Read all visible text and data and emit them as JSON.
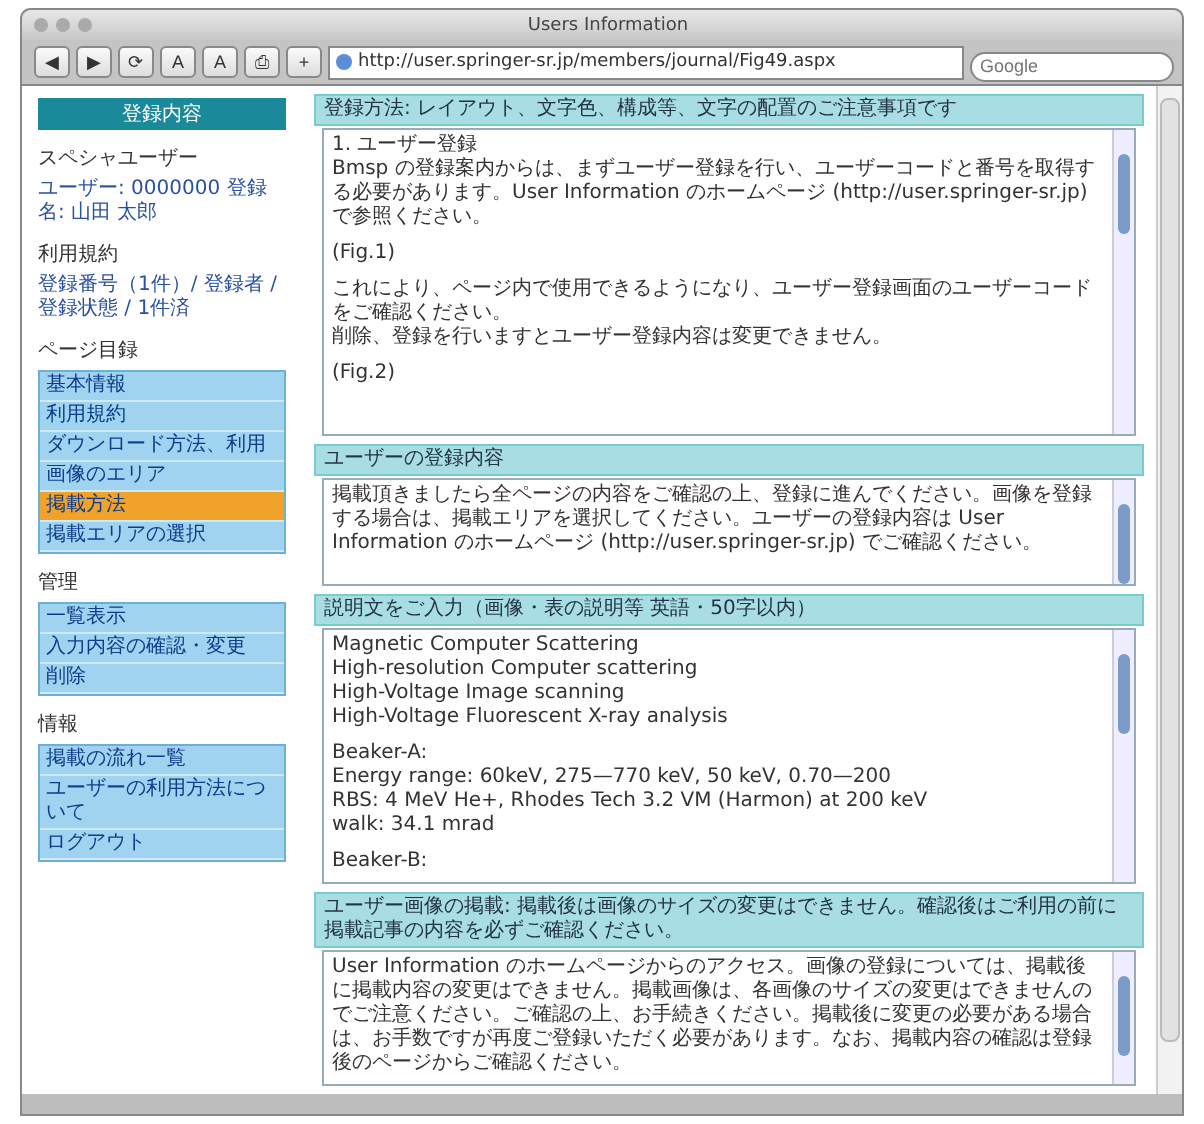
{
  "window": {
    "title": "Users Information"
  },
  "toolbar": {
    "buttons": [
      {
        "label": "◀"
      },
      {
        "label": "▶"
      },
      {
        "label": "⟳"
      },
      {
        "label": "A"
      },
      {
        "label": "A"
      },
      {
        "label": "⎙"
      },
      {
        "label": "+"
      }
    ],
    "url": "http://user.springer-sr.jp/members/journal/Fig49.aspx",
    "search": {
      "placeholder": "Google"
    }
  },
  "sidebar": {
    "header": "登録内容",
    "user_title": "スペシャユーザー",
    "user_line": "ユーザー: 0000000 登録名: 山田 太郎",
    "terms_title": "利用規約",
    "terms_text": "登録番号（1件）/ 登録者 / 登録状態 / 1件済",
    "groups": [
      {
        "title": "ページ目録",
        "items": [
          {
            "label": "基本情報",
            "selected": false
          },
          {
            "label": "利用規約",
            "selected": false
          },
          {
            "label": "ダウンロード方法、利用",
            "selected": false
          },
          {
            "label": "画像のエリア",
            "selected": false
          },
          {
            "label": "掲載方法",
            "selected": true
          },
          {
            "label": "掲載エリアの選択",
            "selected": false
          }
        ]
      },
      {
        "title": "管理",
        "items": [
          {
            "label": "一覧表示",
            "selected": false
          },
          {
            "label": "入力内容の確認・変更",
            "selected": false
          },
          {
            "label": "削除",
            "selected": false
          }
        ]
      },
      {
        "title": "情報",
        "items": [
          {
            "label": "掲載の流れ一覧",
            "selected": false
          },
          {
            "label": "ユーザーの利用方法について",
            "selected": false
          },
          {
            "label": "ログアウト",
            "selected": false
          }
        ]
      }
    ]
  },
  "sections": [
    {
      "header": "登録方法: レイアウト、文字色、構成等、文字の配置のご注意事項です",
      "paragraphs": [
        [
          "1. ユーザー登録",
          "Bmsp の登録案内からは、まずユーザー登録を行い、ユーザーコードと番号を取得する必要があります。User Information のホームページ (http://user.springer-sr.jp) で参照ください。"
        ],
        [
          "(Fig.1)"
        ],
        [
          "これにより、ページ内で使用できるようになり、ユーザー登録画面のユーザーコードをご確認ください。",
          "削除、登録を行いますとユーザー登録内容は変更できません。"
        ],
        [
          "(Fig.2)"
        ]
      ]
    },
    {
      "header": "ユーザーの登録内容",
      "paragraphs": [
        [
          "掲載頂きましたら全ページの内容をご確認の上、登録に進んでください。画像を登録する場合は、掲載エリアを選択してください。ユーザーの登録内容は User Information のホームページ (http://user.springer-sr.jp) でご確認ください。"
        ]
      ]
    },
    {
      "header": "説明文をご入力（画像・表の説明等 英語・50字以内）",
      "paragraphs": [
        [
          "Magnetic Computer Scattering",
          "High-resolution Computer scattering",
          "High-Voltage Image scanning",
          "High-Voltage Fluorescent X-ray analysis"
        ],
        [
          "Beaker-A:",
          "Energy range: 60keV, 275—770 keV, 50 keV, 0.70—200",
          "RBS: 4 MeV He+, Rhodes Tech 3.2 VM (Harmon) at 200 keV",
          "walk: 34.1 mrad"
        ],
        [
          "Beaker-B:"
        ]
      ]
    },
    {
      "header": "ユーザー画像の掲載: 掲載後は画像のサイズの変更はできません。確認後はご利用の前に掲載記事の内容を必ずご確認ください。",
      "paragraphs": [
        [
          "User Information のホームページからのアクセス。画像の登録については、掲載後に掲載内容の変更はできません。掲載画像は、各画像のサイズの変更はできませんのでご注意ください。ご確認の上、お手続きください。掲載後に変更の必要がある場合は、お手数ですが再度ご登録いただく必要があります。なお、掲載内容の確認は登録後のページからご確認ください。"
        ]
      ]
    }
  ]
}
